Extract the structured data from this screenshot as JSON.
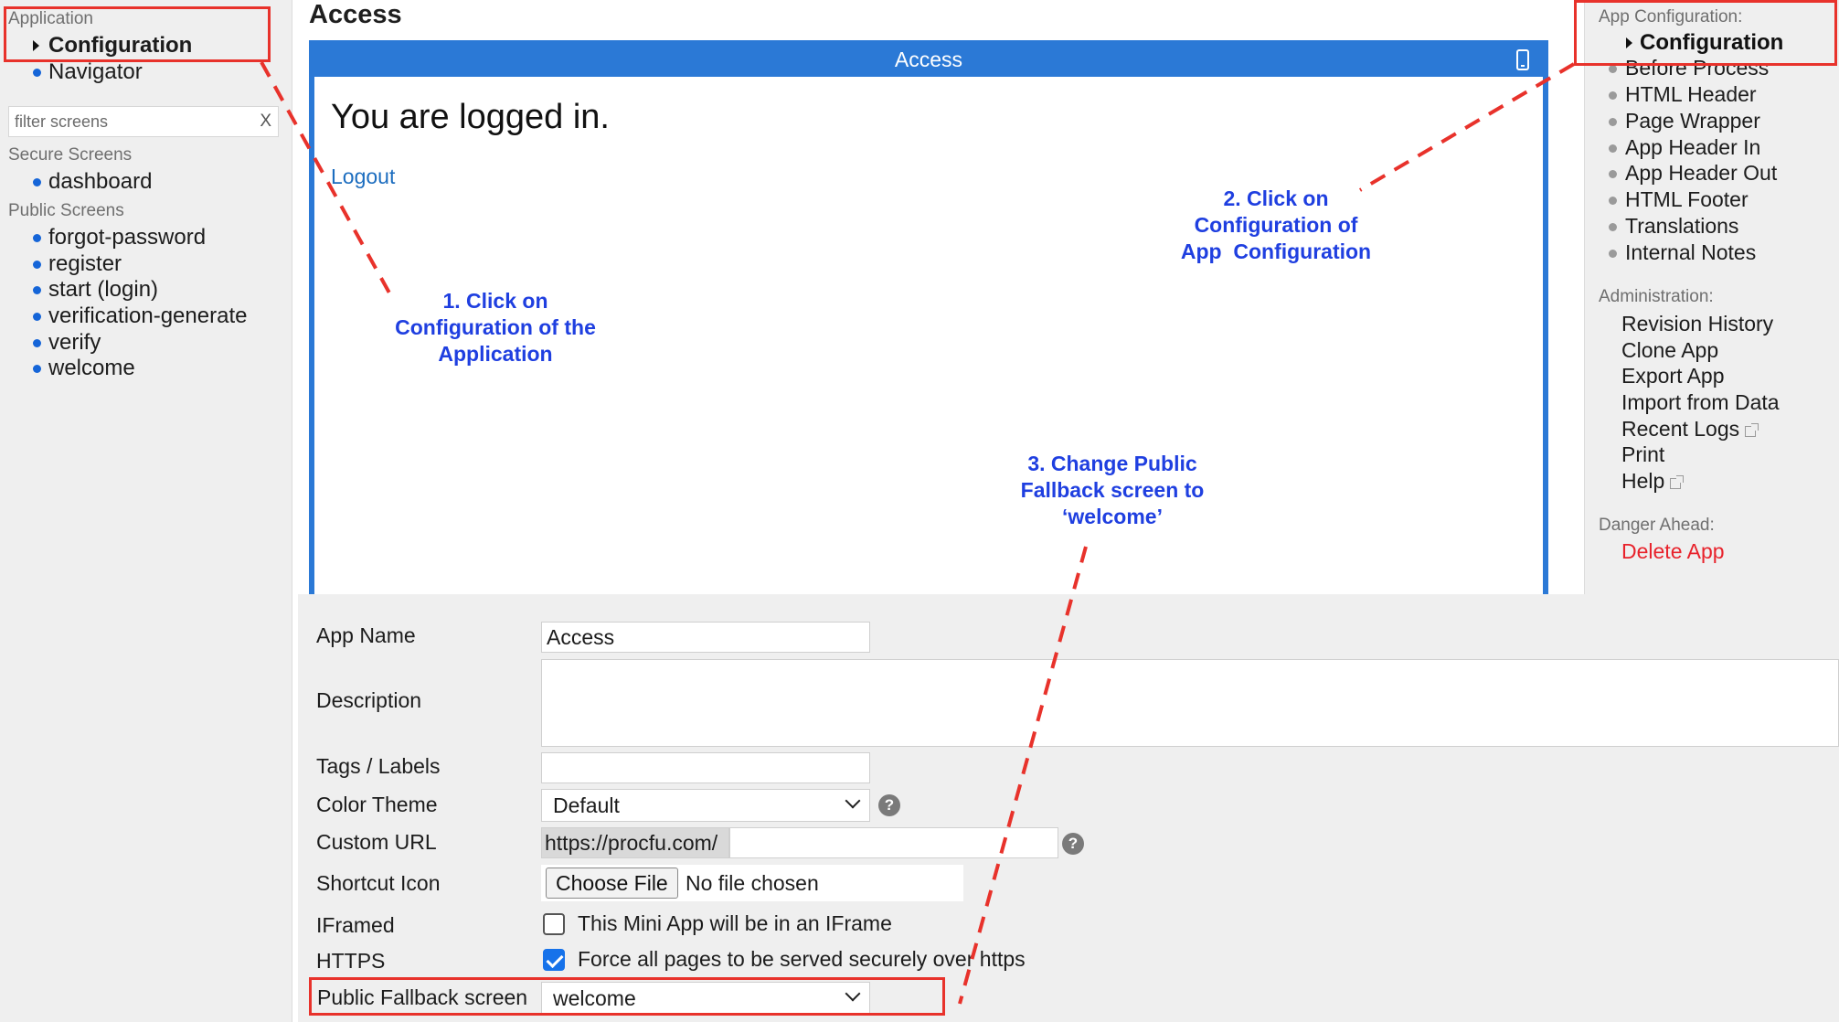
{
  "left_sidebar": {
    "application_caption": "Application",
    "configuration": "Configuration",
    "navigator": "Navigator",
    "filter_placeholder": "filter screens",
    "filter_clear": "X",
    "secure_caption": "Secure Screens",
    "secure_screens": [
      "dashboard"
    ],
    "public_caption": "Public Screens",
    "public_screens": [
      "forgot-password",
      "register",
      "start (login)",
      "verification-generate",
      "verify",
      "welcome"
    ]
  },
  "main": {
    "page_title": "Access",
    "preview_title": "Access",
    "logged_in_message": "You are logged in.",
    "logout_link": "Logout"
  },
  "form": {
    "app_name_label": "App Name",
    "app_name_value": "Access",
    "description_label": "Description",
    "description_value": "",
    "tags_label": "Tags / Labels",
    "tags_value": "",
    "color_theme_label": "Color Theme",
    "color_theme_value": "Default",
    "custom_url_label": "Custom URL",
    "custom_url_prefix": "https://procfu.com/",
    "custom_url_value": "",
    "shortcut_icon_label": "Shortcut Icon",
    "choose_file_label": "Choose File",
    "no_file_text": "No file chosen",
    "iframed_label": "IFramed",
    "iframed_text": "This Mini App will be in an IFrame",
    "iframed_checked": false,
    "https_label": "HTTPS",
    "https_text": "Force all pages to be served securely over https",
    "https_checked": true,
    "fallback_label": "Public Fallback screen",
    "fallback_value": "welcome",
    "help_glyph": "?"
  },
  "right_sidebar": {
    "app_config_caption": "App Configuration:",
    "configuration": "Configuration",
    "config_items": [
      "Before Process",
      "HTML Header",
      "Page Wrapper",
      "App Header In",
      "App Header Out",
      "HTML Footer",
      "Translations",
      "Internal Notes"
    ],
    "admin_caption": "Administration:",
    "revision_history": "Revision History",
    "clone_app": "Clone App",
    "export_app": "Export App",
    "import_from_data": "Import from Data",
    "recent_logs": "Recent Logs",
    "print": "Print",
    "help": "Help",
    "danger_caption": "Danger Ahead:",
    "delete_app": "Delete App"
  },
  "annotations": {
    "step1": [
      "1. Click on",
      "Configuration of the",
      "Application"
    ],
    "step2": [
      "2. Click on",
      "Configuration of",
      "App  Configuration"
    ],
    "step3": [
      "3. Change Public",
      "Fallback screen to",
      "‘welcome’"
    ]
  },
  "colors": {
    "accent_blue": "#2b79d6",
    "link_blue": "#1c6dbf",
    "annotation_blue": "#1f3fe0",
    "annotation_red": "#e8322b",
    "danger_red": "#e8222b"
  }
}
